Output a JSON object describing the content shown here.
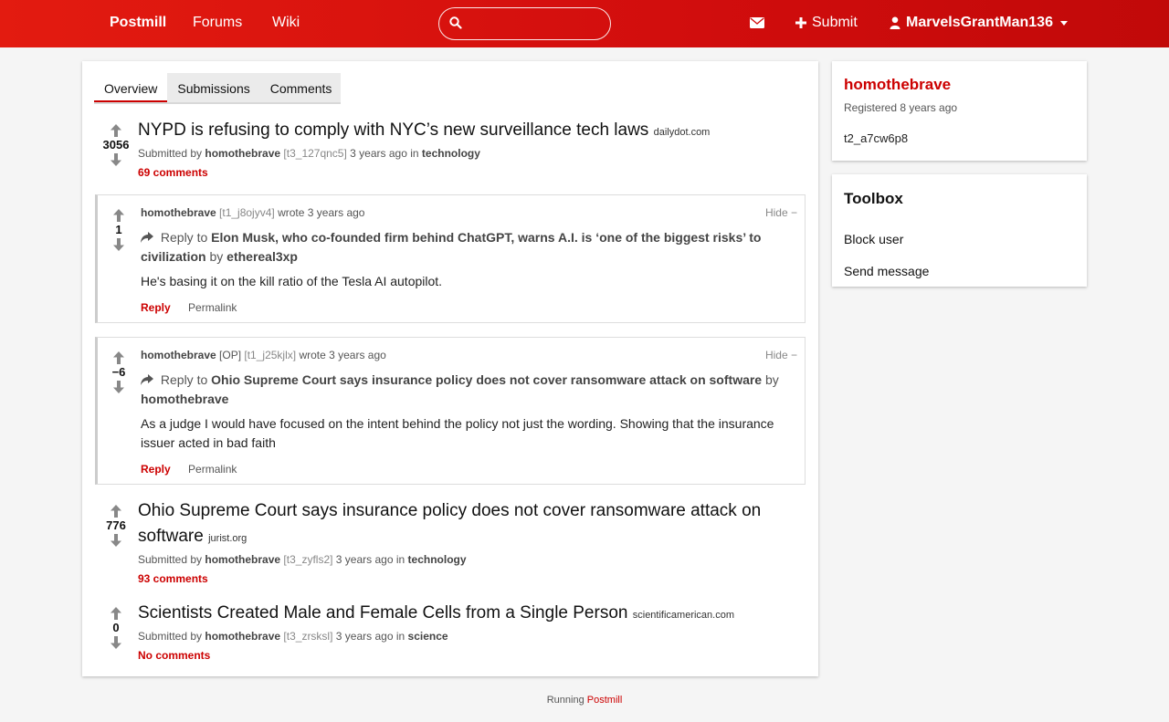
{
  "colors": {
    "accent": "#d10d0d",
    "link": "#cc0000",
    "vote_arrow": "#888888"
  },
  "topbar": {
    "brand": "Postmill",
    "nav": [
      "Forums",
      "Wiki"
    ],
    "search": {
      "value": "",
      "placeholder": ""
    },
    "mail_icon": "envelope-icon",
    "submit_label": "Submit",
    "user_label": "MarvelsGrantMan136"
  },
  "tabs": [
    {
      "label": "Overview",
      "active": true
    },
    {
      "label": "Submissions",
      "active": false
    },
    {
      "label": "Comments",
      "active": false
    }
  ],
  "feed": {
    "sub1": {
      "score": "3056",
      "title": "NYPD is refusing to comply with NYC’s new surveillance tech laws",
      "domain": "dailydot.com",
      "submitted_by": "Submitted by",
      "author": "homothebrave",
      "id": "[t3_127qnc5]",
      "time": "3 years ago",
      "in": "in",
      "forum": "technology",
      "comments": "69 comments"
    },
    "comment1": {
      "score": "1",
      "author": "homothebrave",
      "op": "",
      "id": "[t1_j8ojyv4]",
      "wrote": "wrote 3 years ago",
      "hide": "Hide −",
      "reply_to": "Reply to",
      "reply_title": "Elon Musk, who co-founded firm behind ChatGPT, warns A.I. is ‘one of the biggest risks’ to civilization",
      "by": "by",
      "reply_author": "ethereal3xp",
      "body": "He's basing it on the kill ratio of the Tesla AI autopilot.",
      "reply_label": "Reply",
      "permalink_label": "Permalink"
    },
    "comment2": {
      "score": "−6",
      "author": "homothebrave",
      "op": "[OP]",
      "id": "[t1_j25kjlx]",
      "wrote": "wrote 3 years ago",
      "hide": "Hide −",
      "reply_to": "Reply to",
      "reply_title": "Ohio Supreme Court says insurance policy does not cover ransomware attack on software",
      "by": "by",
      "reply_author": "homothebrave",
      "body": "As a judge I would have focused on the intent behind the policy not just the wording. Showing that the insurance issuer acted in bad faith",
      "reply_label": "Reply",
      "permalink_label": "Permalink"
    },
    "sub2": {
      "score": "776",
      "title": "Ohio Supreme Court says insurance policy does not cover ransomware attack on software",
      "domain": "jurist.org",
      "submitted_by": "Submitted by",
      "author": "homothebrave",
      "id": "[t3_zyfls2]",
      "time": "3 years ago",
      "in": "in",
      "forum": "technology",
      "comments": "93 comments"
    },
    "sub3": {
      "score": "0",
      "title": "Scientists Created Male and Female Cells from a Single Person",
      "domain": "scientificamerican.com",
      "submitted_by": "Submitted by",
      "author": "homothebrave",
      "id": "[t3_zrsksl]",
      "time": "3 years ago",
      "in": "in",
      "forum": "science",
      "comments": "No comments"
    }
  },
  "sidebar": {
    "username": "homothebrave",
    "registered": "Registered 8 years ago",
    "user_id": "t2_a7cw6p8",
    "toolbox_title": "Toolbox",
    "toolbox_items": [
      "Block user",
      "Send message"
    ]
  },
  "footer": {
    "prefix": "Running",
    "link": "Postmill"
  }
}
